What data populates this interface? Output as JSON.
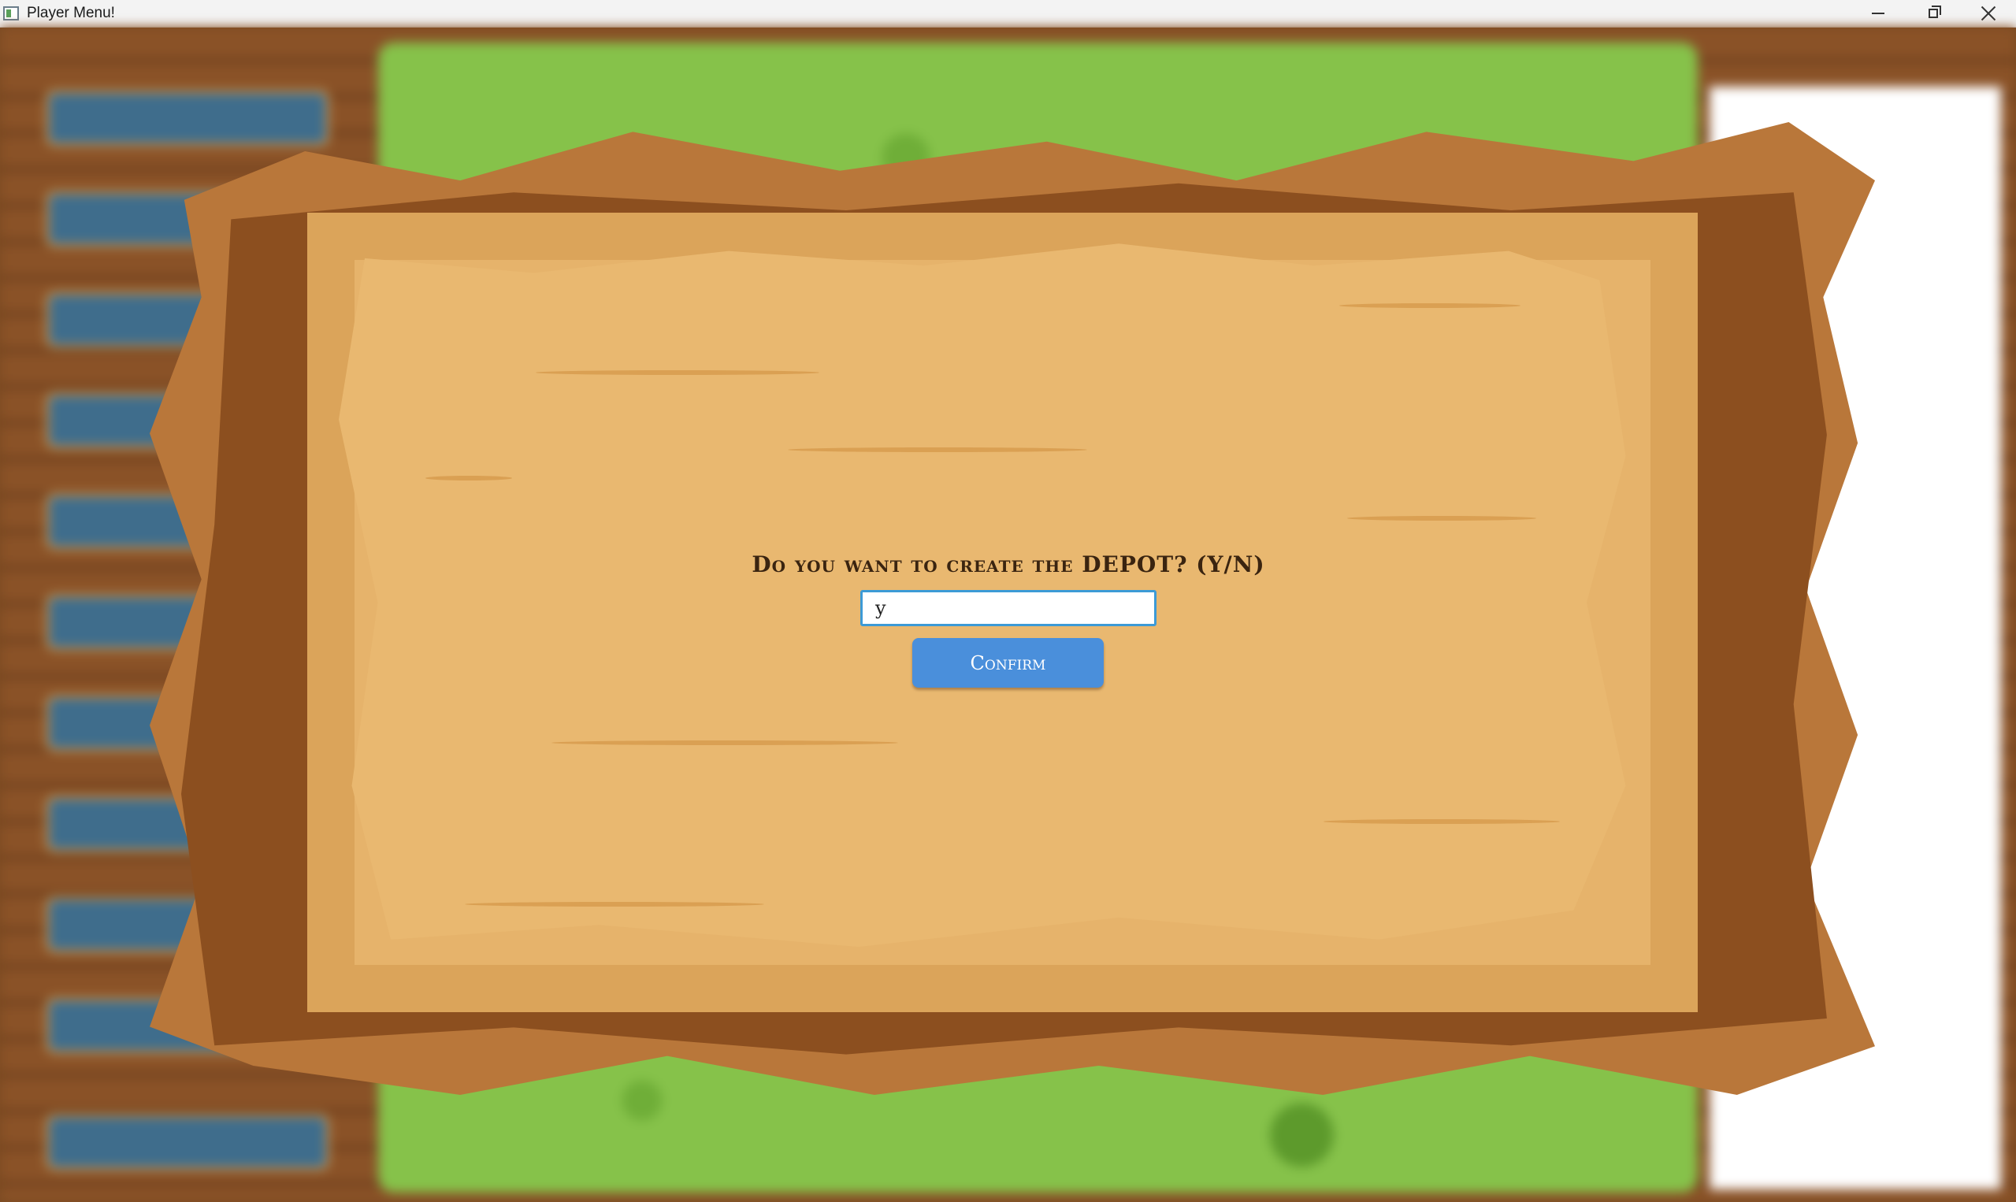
{
  "window": {
    "title": "Player Menu!",
    "icon": "app-icon",
    "controls": {
      "minimize_icon": "minimize-icon",
      "maximize_icon": "restore-icon",
      "close_icon": "close-icon"
    }
  },
  "dialog": {
    "prompt": "Do you want to create the DEPOT? (Y/N)",
    "input_value": "y",
    "confirm_label": "Confirm",
    "colors": {
      "button": "#4a8fdb",
      "input_border": "#3c9ad6",
      "parchment": "#e9b870",
      "wood": "#b9773a"
    }
  }
}
